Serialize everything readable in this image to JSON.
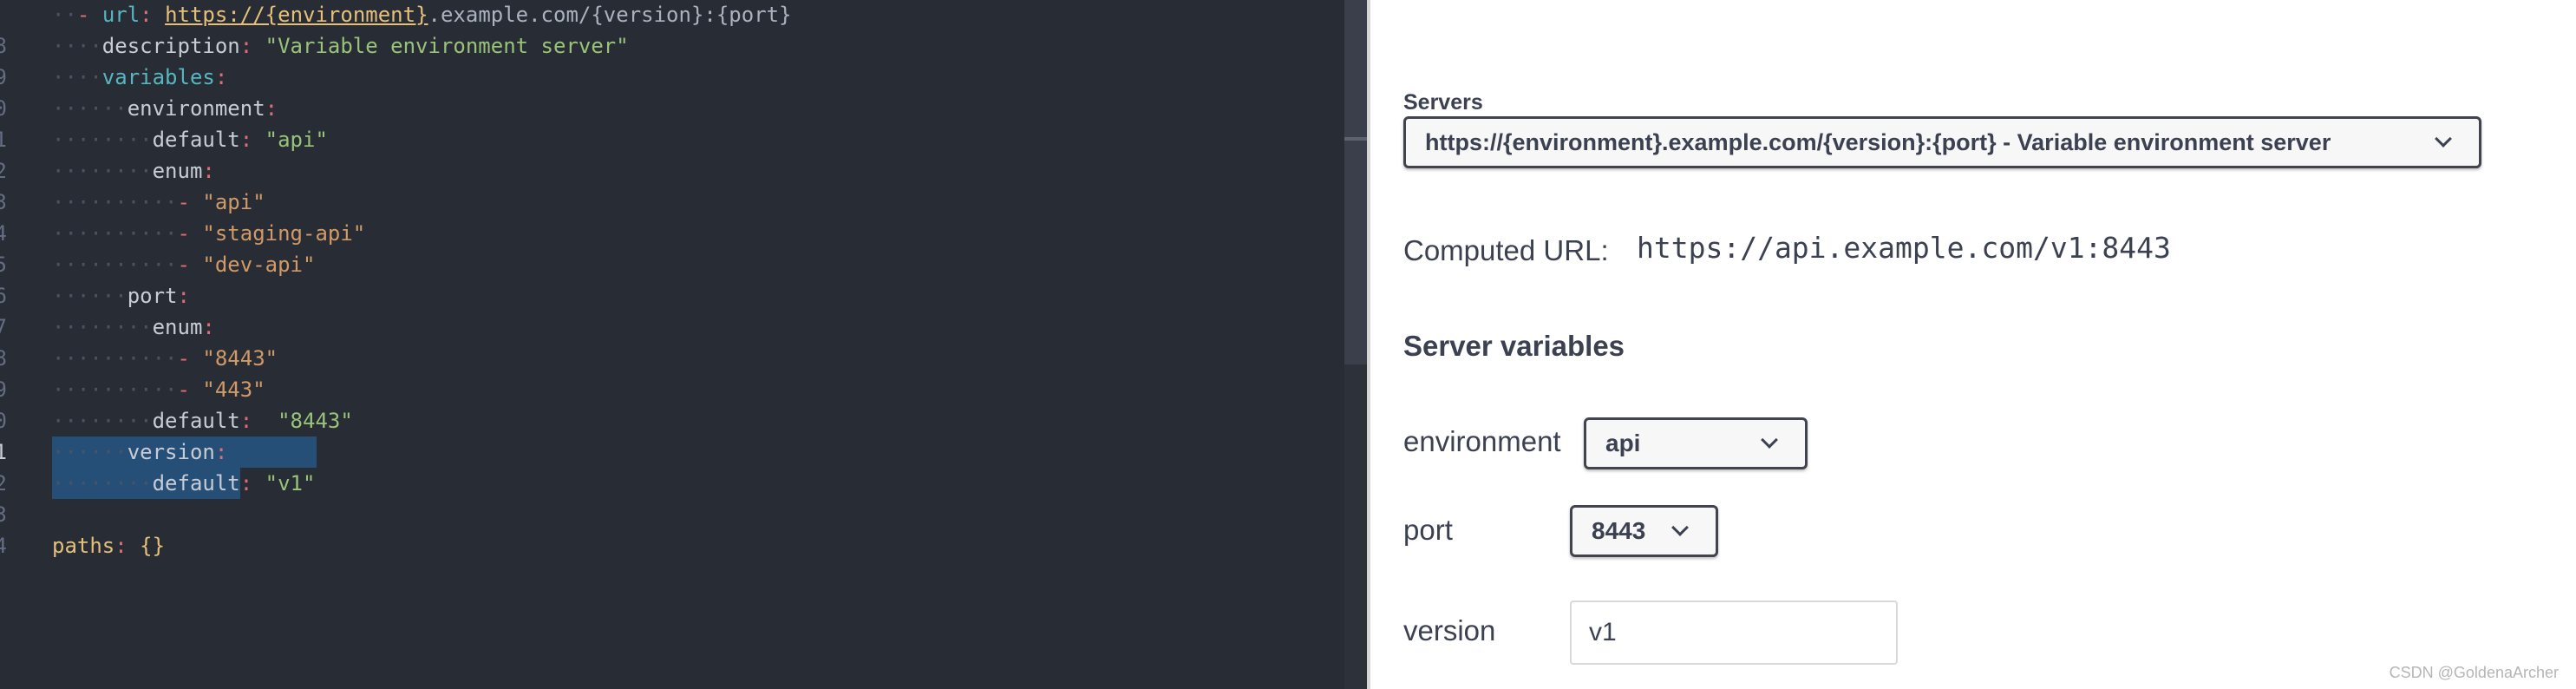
{
  "editor": {
    "lines": [
      {
        "num": "",
        "parts": [
          [
            "ws",
            "··"
          ],
          [
            "dash",
            "- "
          ],
          [
            "keyc",
            "url"
          ],
          [
            "colon",
            ": "
          ],
          [
            "url",
            "https://{environment}"
          ],
          [
            "urlrest",
            ".example.com/{version}:{port}"
          ]
        ]
      },
      {
        "num": "8",
        "parts": [
          [
            "ws",
            "····"
          ],
          [
            "prop",
            "description"
          ],
          [
            "colon",
            ": "
          ],
          [
            "str",
            "\"Variable environment server\""
          ]
        ]
      },
      {
        "num": "9",
        "parts": [
          [
            "ws",
            "····"
          ],
          [
            "keyc",
            "variables"
          ],
          [
            "colon",
            ":"
          ]
        ]
      },
      {
        "num": "0",
        "parts": [
          [
            "ws",
            "······"
          ],
          [
            "prop",
            "environment"
          ],
          [
            "colon",
            ":"
          ]
        ]
      },
      {
        "num": "1",
        "parts": [
          [
            "ws",
            "········"
          ],
          [
            "prop",
            "default"
          ],
          [
            "colon",
            ": "
          ],
          [
            "str",
            "\"api\""
          ]
        ]
      },
      {
        "num": "2",
        "parts": [
          [
            "ws",
            "········"
          ],
          [
            "prop",
            "enum"
          ],
          [
            "colon",
            ":"
          ]
        ]
      },
      {
        "num": "3",
        "parts": [
          [
            "ws",
            "··········"
          ],
          [
            "dash",
            "- "
          ],
          [
            "str2",
            "\"api\""
          ]
        ]
      },
      {
        "num": "4",
        "parts": [
          [
            "ws",
            "··········"
          ],
          [
            "dash",
            "- "
          ],
          [
            "str2",
            "\"staging-api\""
          ]
        ]
      },
      {
        "num": "5",
        "parts": [
          [
            "ws",
            "··········"
          ],
          [
            "dash",
            "- "
          ],
          [
            "str2",
            "\"dev-api\""
          ]
        ]
      },
      {
        "num": "6",
        "parts": [
          [
            "ws",
            "······"
          ],
          [
            "prop",
            "port"
          ],
          [
            "colon",
            ":"
          ]
        ]
      },
      {
        "num": "7",
        "parts": [
          [
            "ws",
            "········"
          ],
          [
            "prop",
            "enum"
          ],
          [
            "colon",
            ":"
          ]
        ]
      },
      {
        "num": "8",
        "parts": [
          [
            "ws",
            "··········"
          ],
          [
            "dash",
            "- "
          ],
          [
            "str2",
            "\"8443\""
          ]
        ]
      },
      {
        "num": "9",
        "parts": [
          [
            "ws",
            "··········"
          ],
          [
            "dash",
            "- "
          ],
          [
            "str2",
            "\"443\""
          ]
        ]
      },
      {
        "num": "0",
        "parts": [
          [
            "ws",
            "········"
          ],
          [
            "prop",
            "default"
          ],
          [
            "colon",
            ":  "
          ],
          [
            "str",
            "\"8443\""
          ]
        ]
      },
      {
        "num": "1",
        "parts": [
          [
            "ws",
            "······"
          ],
          [
            "prop",
            "version"
          ],
          [
            "colon",
            ":"
          ]
        ],
        "highlight": true,
        "active": true
      },
      {
        "num": "2",
        "parts": [
          [
            "ws",
            "········"
          ],
          [
            "prop",
            "default"
          ],
          [
            "colon",
            ": "
          ],
          [
            "str",
            "\"v1\""
          ]
        ],
        "highlight": true,
        "short": true
      },
      {
        "num": "3",
        "parts": []
      },
      {
        "num": "4",
        "parts": [
          [
            "key",
            "paths"
          ],
          [
            "colon",
            ": "
          ],
          [
            "brace",
            "{}"
          ]
        ]
      }
    ]
  },
  "panel": {
    "servers_label": "Servers",
    "server_selected": "https://{environment}.example.com/{version}:{port} - Variable environment server",
    "computed_label": "Computed URL:",
    "computed_value": "https://api.example.com/v1:8443",
    "section_title": "Server variables",
    "variables": {
      "environment": {
        "label": "environment",
        "selected": "api"
      },
      "port": {
        "label": "port",
        "selected": "8443"
      },
      "version": {
        "label": "version",
        "value": "v1"
      }
    }
  },
  "watermark": "CSDN @GoldenaArcher"
}
